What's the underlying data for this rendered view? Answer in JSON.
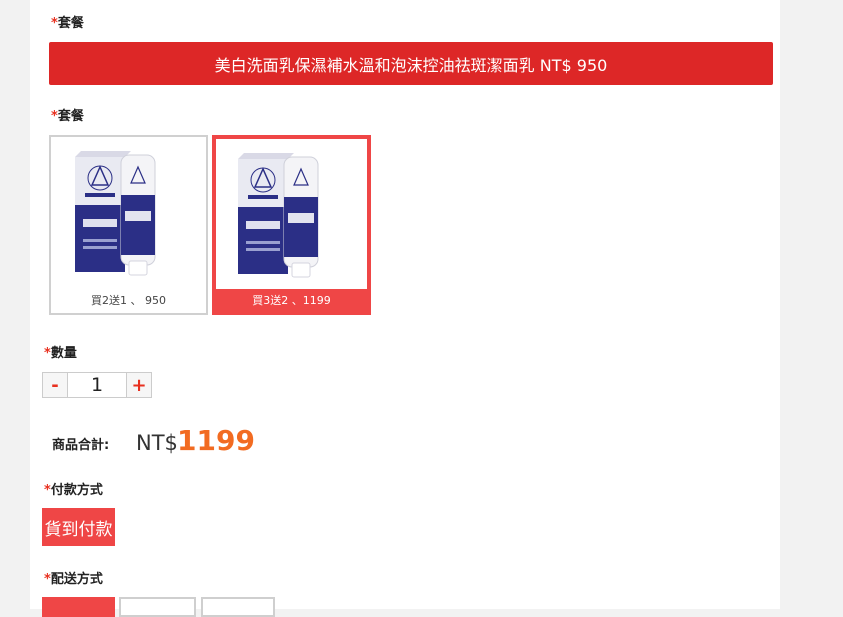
{
  "form": {
    "package_label_1": "套餐",
    "selected_package_text": "美白洗面乳保濕補水溫和泡沫控油祛斑潔面乳 NT$ 950",
    "package_label_2": "套餐",
    "options": [
      {
        "caption": "買2送1 、 950",
        "selected": false
      },
      {
        "caption": "買3送2 、1199",
        "selected": true
      }
    ],
    "quantity_label": "數量",
    "quantity_minus": "-",
    "quantity_value": "1",
    "quantity_plus": "+",
    "total_label": "商品合計:",
    "total_prefix": "NT$",
    "total_value": "1199",
    "payment_label": "付款方式",
    "payment_option": "貨到付款",
    "shipping_label": "配送方式",
    "required_mark": "*"
  },
  "colors": {
    "accent_red": "#dd2727",
    "selected_red": "#ef4646",
    "price_orange": "#f26b21",
    "product_blue": "#2b2f86"
  }
}
